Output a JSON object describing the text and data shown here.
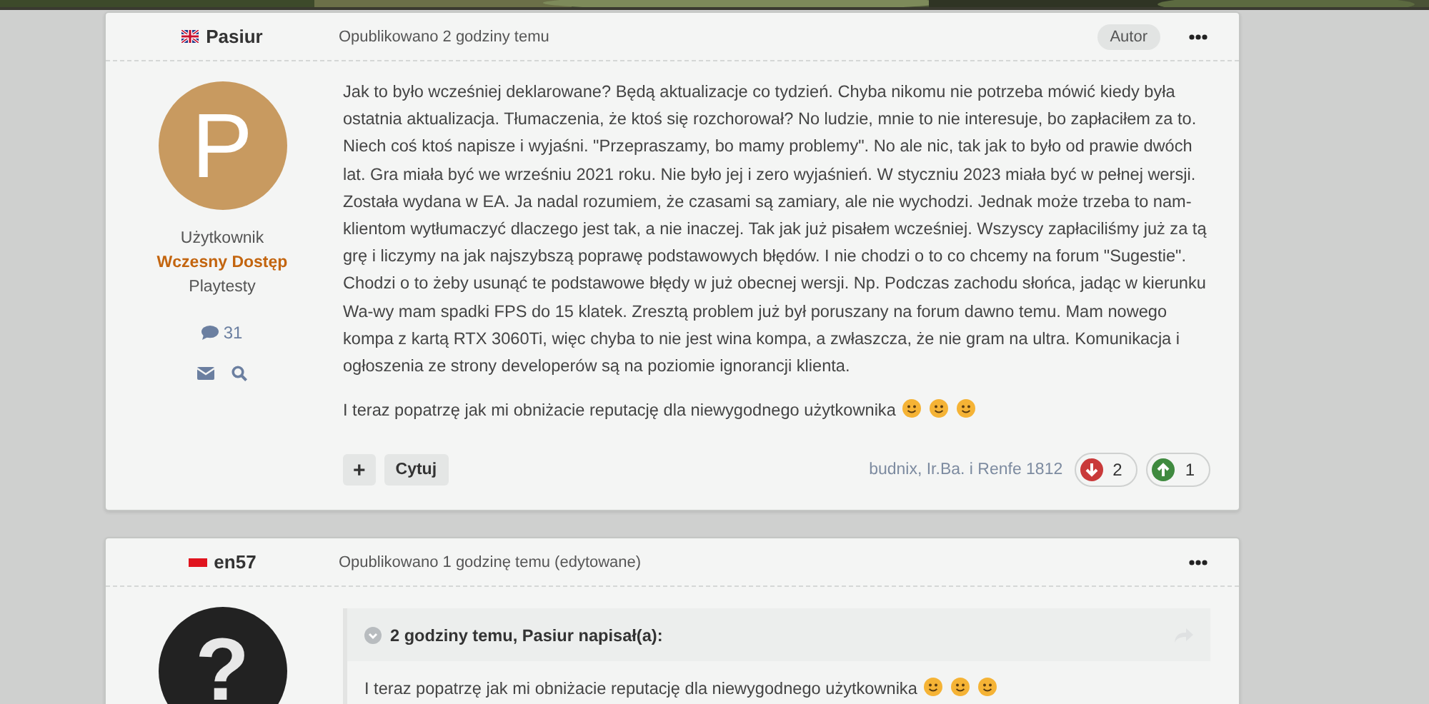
{
  "posts": [
    {
      "author": "Pasiur",
      "flag": {
        "kind": "uk"
      },
      "posted": "Opublikowano 2 godziny temu",
      "badge": "Autor",
      "avatar": {
        "kind": "letter",
        "symbol": "P",
        "color": "#c89a60"
      },
      "rank": "Użytkownik",
      "group": "Wczesny Dostęp",
      "subgroup": "Playtesty",
      "post_count": "31",
      "paragraphs": [
        {
          "text": "Jak to było wcześniej deklarowane? Będą aktualizacje co tydzień. Chyba nikomu nie potrzeba mówić kiedy była ostatnia aktualizacja. Tłumaczenia, że ktoś się rozchorował? No ludzie, mnie to nie interesuje, bo zapłaciłem za to. Niech coś ktoś napisze i wyjaśni. \"Przepraszamy, bo mamy problemy\". No ale nic, tak jak to było od prawie dwóch lat. Gra miała być we wrześniu 2021 roku. Nie było jej i zero wyjaśnień. W styczniu 2023 miała być w pełnej wersji. Została wydana w EA. Ja nadal rozumiem, że czasami są zamiary, ale nie wychodzi. Jednak może trzeba to nam-klientom wytłumaczyć dlaczego jest tak, a nie inaczej. Tak jak już pisałem wcześniej. Wszyscy zapłaciliśmy już za tą grę i liczymy na jak najszybszą poprawę podstawowych błędów. I nie chodzi o to co chcemy na forum \"Sugestie\". Chodzi o to żeby usunąć te podstawowe błędy w już obecnej wersji. Np. Podczas zachodu słońca, jadąc w kierunku Wa-wy mam spadki FPS do 15 klatek. Zresztą problem już był poruszany na forum dawno temu. Mam nowego kompa z kartą RTX 3060Ti, więc chyba to nie jest wina kompa, a zwłaszcza, że nie gram na ultra. Komunikacja i ogłoszenia ze strony developerów są na poziomie ignorancji klienta."
        },
        {
          "text": "I teraz popatrzę jak mi obniżacie reputację dla niewygodnego użytkownika",
          "emoticons": [
            {
              "kind": "smile"
            },
            {
              "kind": "smile"
            },
            {
              "kind": "smile"
            }
          ]
        }
      ],
      "actions": [
        {
          "kind": "add",
          "label": "+"
        },
        {
          "kind": "quote",
          "label": "Cytuj"
        }
      ],
      "reactors": "budnix, Ir.Ba. i Renfe 1812",
      "reactions": [
        {
          "kind": "down",
          "count": "2"
        },
        {
          "kind": "up",
          "count": "1"
        }
      ]
    },
    {
      "author": "en57",
      "flag": {
        "kind": "pl"
      },
      "posted": "Opublikowano 1 godzinę temu (edytowane)",
      "avatar": {
        "kind": "unknown",
        "symbol": "?",
        "color": "#222222"
      },
      "quote": {
        "header": "2 godziny temu, Pasiur napisał(a):",
        "text": "I teraz popatrzę jak mi obniżacie reputację dla niewygodnego użytkownika",
        "emoticons": [
          {
            "kind": "smile"
          },
          {
            "kind": "smile"
          },
          {
            "kind": "smile"
          }
        ]
      }
    }
  ]
}
